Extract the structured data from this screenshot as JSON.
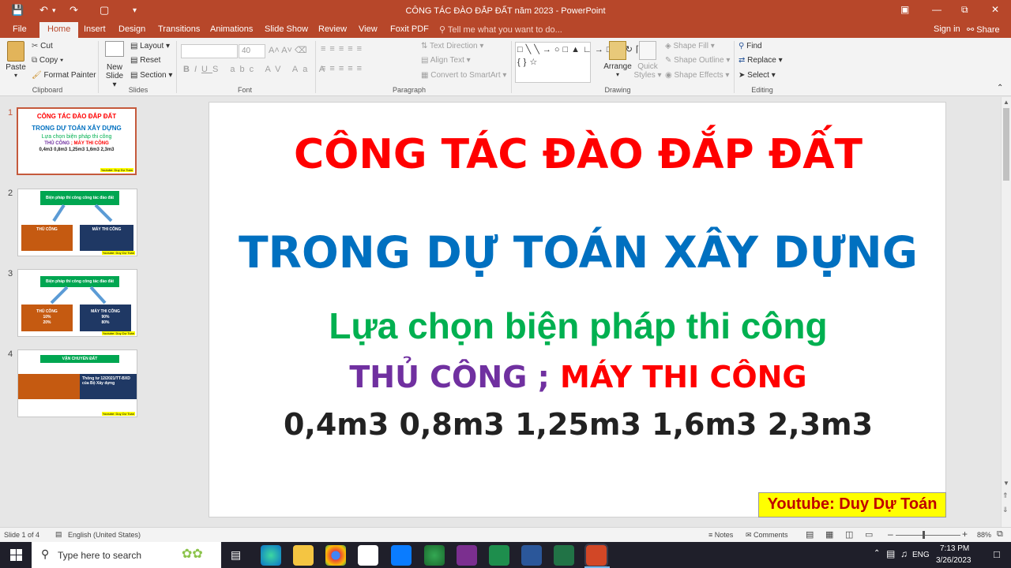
{
  "titlebar": {
    "document_title": "CÔNG TÁC ĐÀO ĐẮP ĐẤT năm 2023 - PowerPoint"
  },
  "tabs": [
    "File",
    "Home",
    "Insert",
    "Design",
    "Transitions",
    "Animations",
    "Slide Show",
    "Review",
    "View",
    "Foxit PDF"
  ],
  "tell_me": "Tell me what you want to do...",
  "account": {
    "sign_in": "Sign in",
    "share": "Share"
  },
  "ribbon": {
    "clipboard": {
      "paste": "Paste",
      "cut": "Cut",
      "copy": "Copy",
      "format_painter": "Format Painter",
      "label": "Clipboard"
    },
    "slides": {
      "new_slide": "New",
      "new_slide2": "Slide",
      "layout": "Layout",
      "reset": "Reset",
      "section": "Section",
      "label": "Slides"
    },
    "font": {
      "size": "40",
      "label": "Font"
    },
    "paragraph": {
      "text_direction": "Text Direction",
      "align_text": "Align Text",
      "smartart": "Convert to SmartArt",
      "label": "Paragraph"
    },
    "drawing": {
      "arrange": "Arrange",
      "quick": "Quick",
      "styles": "Styles",
      "shape_fill": "Shape Fill",
      "shape_outline": "Shape Outline",
      "shape_effects": "Shape Effects",
      "label": "Drawing"
    },
    "editing": {
      "find": "Find",
      "replace": "Replace",
      "select": "Select",
      "label": "Editing"
    }
  },
  "thumbnails": [
    {
      "num": "1",
      "l1": "CÔNG TÁC ĐÀO ĐẮP ĐẤT",
      "l2": "TRONG DỰ TOÁN XÂY DỰNG",
      "l3": "Lựa chọn biện pháp thi công",
      "l4a": "THỦ CÔNG",
      "l4b": " ; MÁY THI CÔNG",
      "l5": "0,4m3 0,8m3 1,25m3 1,6m3 2,3m3",
      "footer": "Youtube: Duy Dự Toán"
    },
    {
      "num": "2",
      "head": "Biện pháp thi công công tác đào đất",
      "left": "THỦ CÔNG",
      "right": "MÁY THI CÔNG",
      "footer": "Youtube: Duy Dự Toán"
    },
    {
      "num": "3",
      "head": "Biện pháp thi công công tác đào đất",
      "left": "THỦ CÔNG",
      "left2": "10%",
      "left3": "20%",
      "right": "MÁY THI CÔNG",
      "right2": "90%",
      "right3": "80%",
      "footer": "Youtube: Duy Dự Toán"
    },
    {
      "num": "4",
      "head": "VẬN CHUYỂN ĐẤT",
      "right": "Thông tư 12/2021/TT-BXD của Bộ Xây dựng",
      "footer": "Youtube: Duy Dự Toán"
    }
  ],
  "slide": {
    "title1": "CÔNG TÁC ĐÀO ĐẮP ĐẤT",
    "title2": "TRONG DỰ TOÁN XÂY DỰNG",
    "subtitle": "Lựa chọn biện pháp thi công",
    "line4a": "THỦ CÔNG",
    "line4sep": " ; ",
    "line4b": "MÁY THI CÔNG",
    "line5": "0,4m3 0,8m3 1,25m3 1,6m3 2,3m3",
    "badge": "Youtube: Duy Dự Toán"
  },
  "status": {
    "slide_of": "Slide 1 of 4",
    "language": "English (United States)",
    "notes": "Notes",
    "comments": "Comments",
    "zoom": "88%"
  },
  "taskbar": {
    "search_placeholder": "Type here to search",
    "time": "7:13 PM",
    "date": "3/26/2023",
    "lang": "ENG"
  },
  "colors": {
    "accent": "#b7472a",
    "red": "#ff0000",
    "blue": "#0070c0",
    "green": "#00b050",
    "purple": "#7030a0",
    "badge_bg": "#ffff00"
  }
}
